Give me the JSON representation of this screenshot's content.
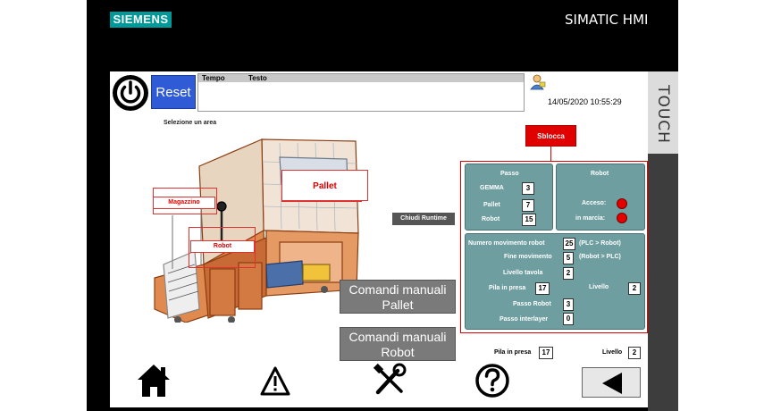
{
  "brand": {
    "logo_text": "SIEMENS",
    "product": "SIMATIC HMI",
    "touch_label": "TOUCH"
  },
  "toolbar": {
    "reset_label": "Reset",
    "datetime": "14/05/2020 10:55:29"
  },
  "alarm_view": {
    "col_time": "Tempo",
    "col_text": "Testo"
  },
  "machine_view": {
    "select_area_label": "Selezione un area",
    "zones": {
      "pallet": "Pallet",
      "magazzino": "Magazzino",
      "robot": "Robot"
    },
    "close_runtime": "Chiudi Runtime"
  },
  "unlock_label": "Sblocca",
  "passo": {
    "title": "Passo",
    "gemma_label": "GEMMA",
    "gemma_value": "3",
    "pallet_label": "Pallet",
    "pallet_value": "7",
    "robot_label": "Robot",
    "robot_value": "15"
  },
  "robot_status": {
    "title": "Robot",
    "on_label": "Acceso:",
    "running_label": "in marcia:"
  },
  "movement": {
    "num_label": "Numero movimento robot",
    "num_value": "25",
    "num_note": "(PLC > Robot)",
    "end_label": "Fine movimento",
    "end_value": "5",
    "end_note": "(Robot > PLC)",
    "tavola_label": "Livello tavola",
    "tavola_value": "2",
    "pila_label": "Pila in presa",
    "pila_value": "17",
    "livello_label": "Livello",
    "livello_value": "2",
    "passo_robot_label": "Passo Robot",
    "passo_robot_value": "3",
    "interlayer_label": "Passo interlayer",
    "interlayer_value": "0"
  },
  "manual_buttons": {
    "pallet": {
      "line1": "Comandi manuali",
      "line2": "Pallet"
    },
    "robot": {
      "line1": "Comandi manuali",
      "line2": "Robot"
    }
  },
  "bottom_status": {
    "pila_label": "Pila in presa",
    "pila_value": "17",
    "livello_label": "Livello",
    "livello_value": "2"
  },
  "nav_icons": [
    "home-icon",
    "warning-icon",
    "tools-icon",
    "help-icon",
    "back-arrow-icon"
  ],
  "colors": {
    "panel": "#6e9ea0",
    "alert_red": "#e00000",
    "reset_blue": "#2f5bd6",
    "siemens_teal": "#00999a"
  }
}
